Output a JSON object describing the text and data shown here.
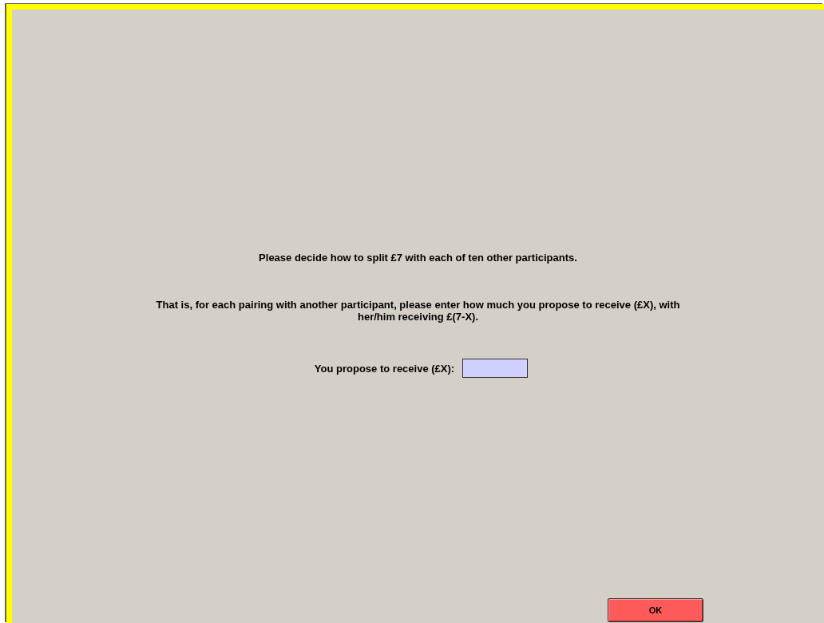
{
  "instructions": [
    "Please decide how to split £7 with each of ten other participants.",
    "That is, for each pairing with another participant, please enter how much you propose to receive (£X), with her/him receiving £(7-X)."
  ],
  "proposal": {
    "label": "You propose to receive (£X):",
    "focused": true
  },
  "buttons": [
    {
      "label": "OK"
    }
  ]
}
